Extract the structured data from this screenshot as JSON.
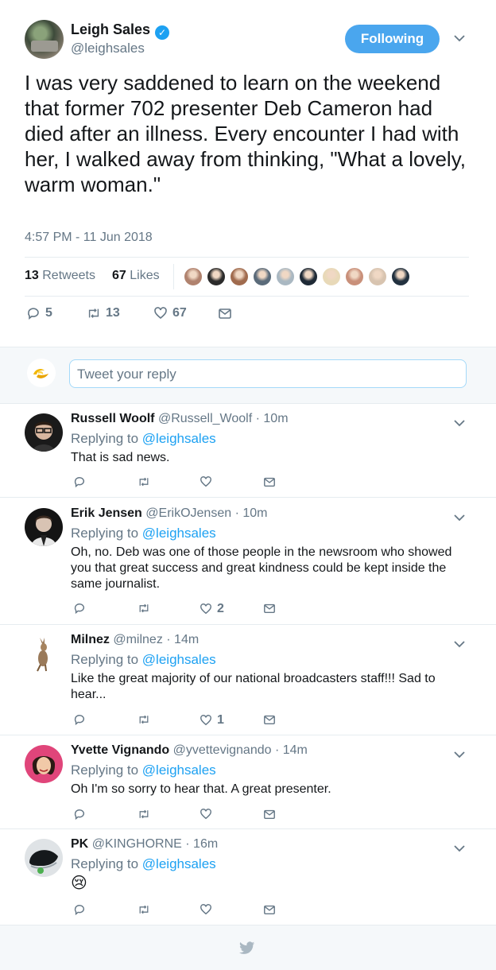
{
  "tweet": {
    "author_name": "Leigh Sales",
    "author_handle": "@leighsales",
    "follow_label": "Following",
    "text": "I was very saddened to learn on the weekend that former 702 presenter Deb Cameron had died after an illness.  Every encounter I had with her, I walked away from thinking, \"What a lovely, warm woman.\"",
    "timestamp": "4:57 PM - 11 Jun 2018",
    "retweets_count": "13",
    "retweets_label": "Retweets",
    "likes_count": "67",
    "likes_label": "Likes",
    "reply_count": "5",
    "retweet_action_count": "13",
    "like_action_count": "67",
    "liker_colors": [
      "#b0826e",
      "#2b2b2b",
      "#a06b4e",
      "#5b6b7a",
      "#aab8c2",
      "#1f2a36",
      "#e8d9b8",
      "#c9907a",
      "#d8c4b0",
      "#22313f"
    ]
  },
  "reply_box": {
    "placeholder": "Tweet your reply"
  },
  "replies": [
    {
      "name": "Russell Woolf",
      "handle": "@Russell_Woolf",
      "time": "· 10m",
      "replying_prefix": "Replying to",
      "replying_to": "@leighsales",
      "text": "That is sad news.",
      "likes": ""
    },
    {
      "name": "Erik Jensen",
      "handle": "@ErikOJensen",
      "time": "· 10m",
      "replying_prefix": "Replying to",
      "replying_to": "@leighsales",
      "text": "Oh, no. Deb was one of those people in the newsroom who showed you that great success and great kindness could be kept inside the same journalist.",
      "likes": "2"
    },
    {
      "name": "Milnez",
      "handle": "@milnez",
      "time": "· 14m",
      "replying_prefix": "Replying to",
      "replying_to": "@leighsales",
      "text": "Like the great majority of our national broadcasters staff!!! Sad to hear...",
      "likes": "1"
    },
    {
      "name": "Yvette Vignando",
      "handle": "@yvettevignando",
      "time": "· 14m",
      "replying_prefix": "Replying to",
      "replying_to": "@leighsales",
      "text": "Oh I'm so sorry to hear that. A great presenter.",
      "likes": ""
    },
    {
      "name": "PK",
      "handle": "@KINGHORNE",
      "time": "· 16m",
      "replying_prefix": "Replying to",
      "replying_to": "@leighsales",
      "text": "😢",
      "likes": ""
    }
  ],
  "icons": {
    "verified": "verified-badge-icon",
    "caret": "chevron-down-icon",
    "reply": "reply-icon",
    "retweet": "retweet-icon",
    "like": "heart-icon",
    "dm": "envelope-icon",
    "footer": "twitter-bird-icon"
  },
  "colors": {
    "accent": "#1da1f2",
    "follow_button": "#4aa6ee",
    "muted": "#657786"
  }
}
